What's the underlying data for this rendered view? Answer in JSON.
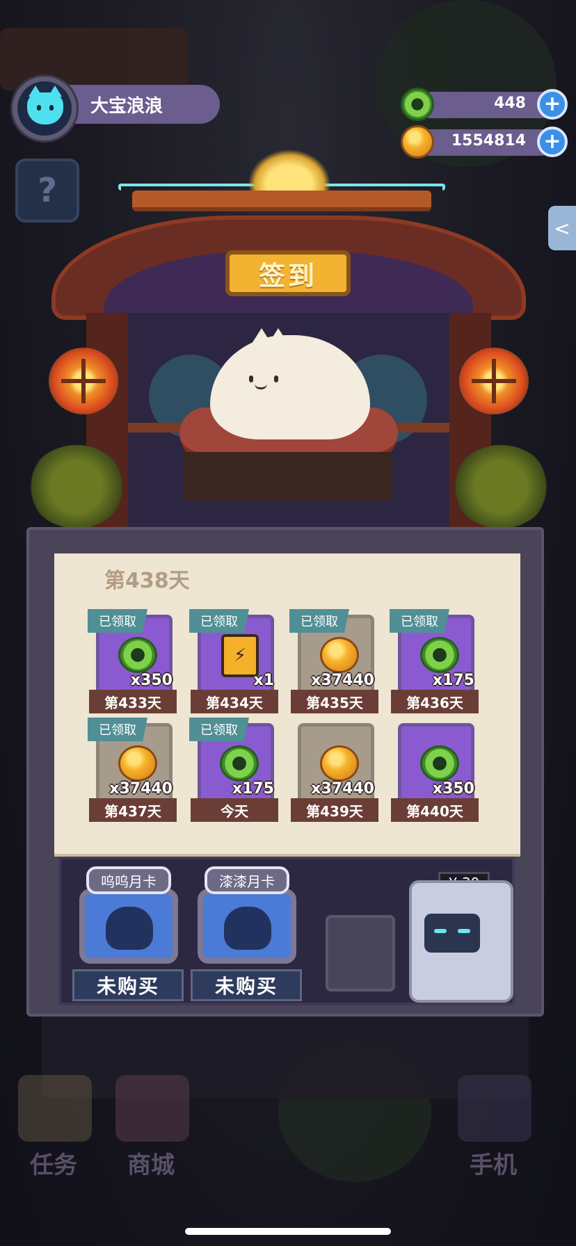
{
  "profile": {
    "name": "大宝浪浪",
    "avatar_icon": "cat-face-icon"
  },
  "mystery_box": {
    "symbol": "?"
  },
  "currencies": [
    {
      "name": "jade-coin",
      "amount": "448",
      "icon": "jade-coin-icon"
    },
    {
      "name": "gold-coin",
      "amount": "1554814",
      "icon": "gold-coin-icon"
    }
  ],
  "plus_symbol": "+",
  "share_symbol": "<",
  "shrine": {
    "sign": "签到"
  },
  "checkin": {
    "title": "第438天",
    "claimed_label": "已领取",
    "days": [
      {
        "day": "第433天",
        "qty": "x350",
        "reward": "jade",
        "claimed": true,
        "bg": "purple"
      },
      {
        "day": "第434天",
        "qty": "x1",
        "reward": "battery",
        "claimed": true,
        "bg": "purple"
      },
      {
        "day": "第435天",
        "qty": "x37440",
        "reward": "gold",
        "claimed": true,
        "bg": "beige"
      },
      {
        "day": "第436天",
        "qty": "x175",
        "reward": "jade",
        "claimed": true,
        "bg": "purple"
      },
      {
        "day": "第437天",
        "qty": "x37440",
        "reward": "gold",
        "claimed": true,
        "bg": "beige"
      },
      {
        "day": "今天",
        "qty": "x175",
        "reward": "jade",
        "claimed": true,
        "bg": "purple"
      },
      {
        "day": "第439天",
        "qty": "x37440",
        "reward": "gold",
        "claimed": false,
        "bg": "beige"
      },
      {
        "day": "第440天",
        "qty": "x350",
        "reward": "jade",
        "claimed": false,
        "bg": "purple"
      }
    ]
  },
  "monthly_cards": [
    {
      "name": "呜呜月卡",
      "status": "未购买"
    },
    {
      "name": "漆漆月卡",
      "status": "未购买"
    }
  ],
  "shop_machine": {
    "price": "¥ 30"
  },
  "bottom_nav": [
    {
      "label": "任务",
      "icon": "task-book-icon"
    },
    {
      "label": "商城",
      "icon": "shop-icon"
    },
    {
      "label": "手机",
      "icon": "phone-icon"
    }
  ],
  "colors": {
    "panel": "#4a4458",
    "paper": "#efe5d3",
    "claimed_tag": "#4f8f95",
    "day_tag": "#6a3e36",
    "purple_card": "#8a5bd0",
    "beige_card": "#a79c8c",
    "currency_pill": "#6b5d8e",
    "plus": "#3b8fe6"
  }
}
